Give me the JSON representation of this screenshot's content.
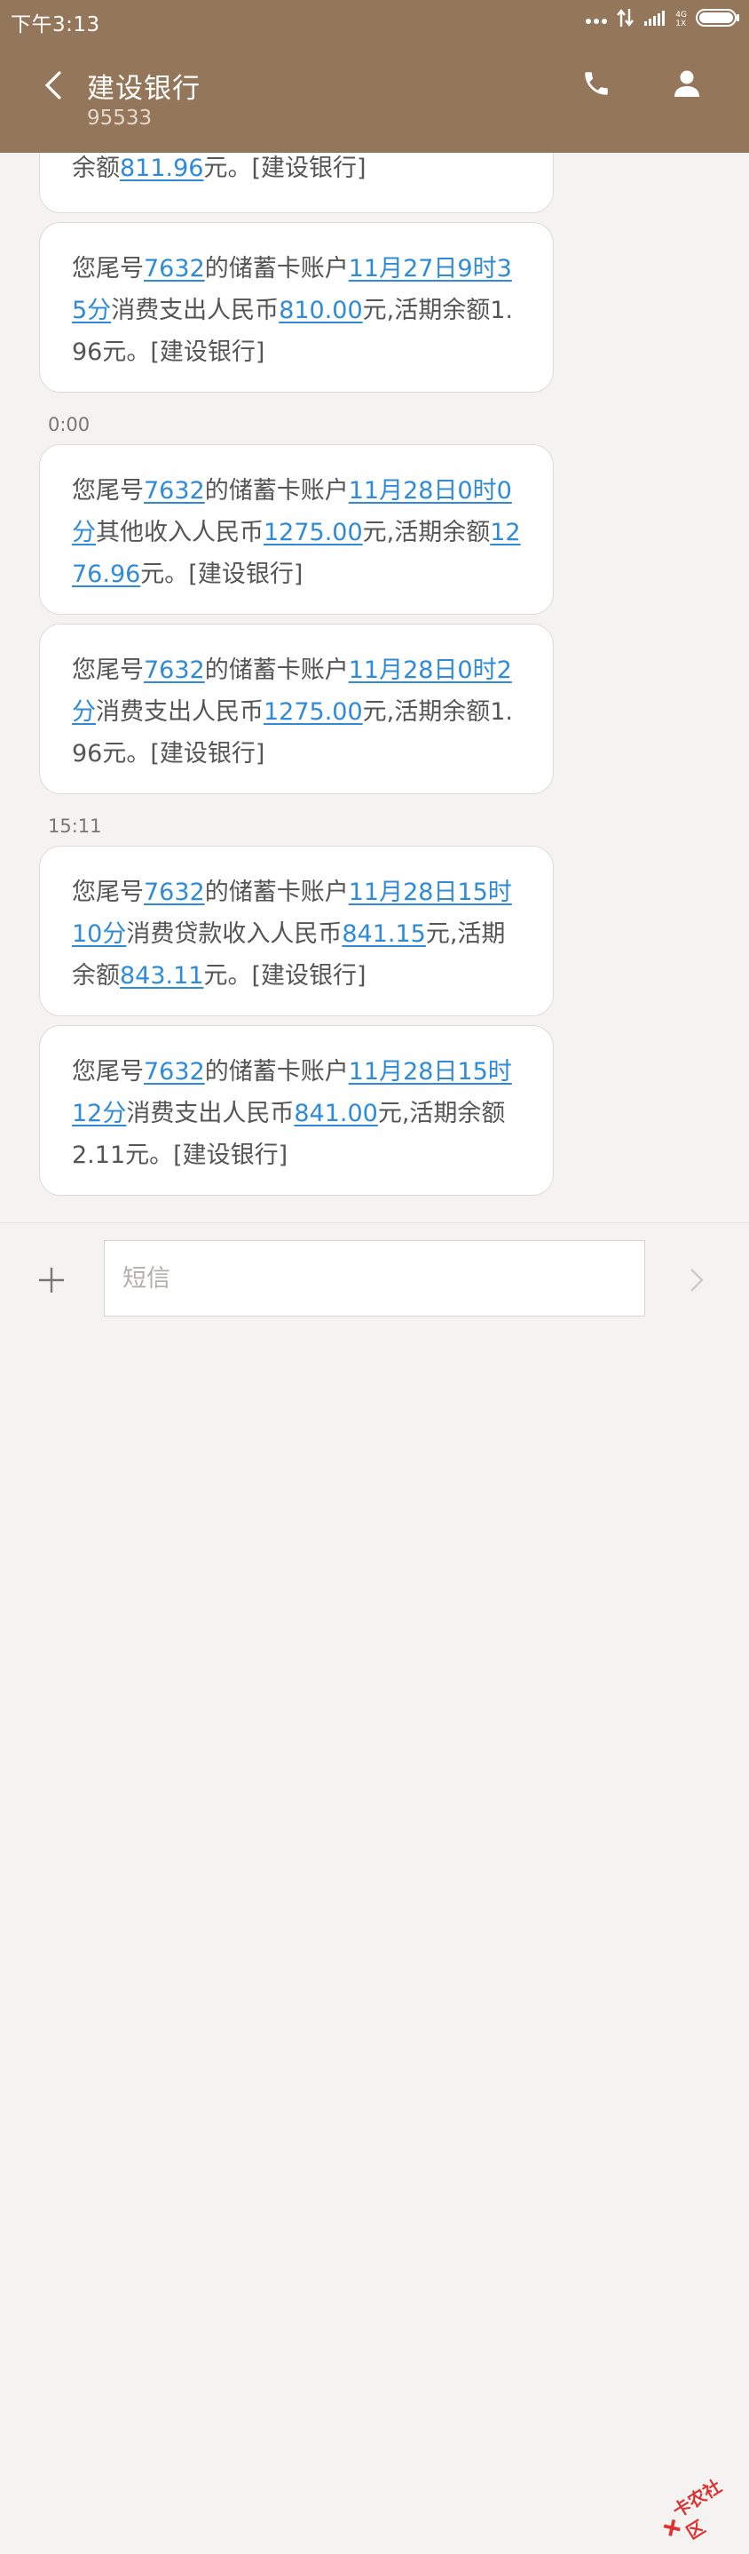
{
  "status_bar": {
    "time": "下午3:13",
    "network_label_top": "4G",
    "network_label_bottom": "1X"
  },
  "header": {
    "contact_name": "建设银行",
    "contact_number": "95533"
  },
  "messages": [
    {
      "segments": [
        {
          "t": "余额"
        },
        {
          "t": "811.96",
          "link": true
        },
        {
          "t": "元。[建设银行]"
        }
      ]
    },
    {
      "segments": [
        {
          "t": "您尾号"
        },
        {
          "t": "7632",
          "link": true
        },
        {
          "t": "的储蓄卡账户"
        },
        {
          "t": "11月27日9时35分",
          "link": true
        },
        {
          "t": "消费支出人民币"
        },
        {
          "t": "810.00",
          "link": true
        },
        {
          "t": "元,活期余额1.96元。[建设银行]"
        }
      ]
    },
    {
      "segments": [
        {
          "t": "您尾号"
        },
        {
          "t": "7632",
          "link": true
        },
        {
          "t": "的储蓄卡账户"
        },
        {
          "t": "11月28日0时0分",
          "link": true
        },
        {
          "t": "其他收入人民币"
        },
        {
          "t": "1275.00",
          "link": true
        },
        {
          "t": "元,活期余额"
        },
        {
          "t": "1276.96",
          "link": true
        },
        {
          "t": "元。[建设银行]"
        }
      ]
    },
    {
      "segments": [
        {
          "t": "您尾号"
        },
        {
          "t": "7632",
          "link": true
        },
        {
          "t": "的储蓄卡账户"
        },
        {
          "t": "11月28日0时2分",
          "link": true
        },
        {
          "t": "消费支出人民币"
        },
        {
          "t": "1275.00",
          "link": true
        },
        {
          "t": "元,活期余额1.96元。[建设银行]"
        }
      ]
    },
    {
      "segments": [
        {
          "t": "您尾号"
        },
        {
          "t": "7632",
          "link": true
        },
        {
          "t": "的储蓄卡账户"
        },
        {
          "t": "11月28日15时10分",
          "link": true
        },
        {
          "t": "消费贷款收入人民币"
        },
        {
          "t": "841.15",
          "link": true
        },
        {
          "t": "元,活期余额"
        },
        {
          "t": "843.11",
          "link": true
        },
        {
          "t": "元。[建设银行]"
        }
      ]
    },
    {
      "segments": [
        {
          "t": "您尾号"
        },
        {
          "t": "7632",
          "link": true
        },
        {
          "t": "的储蓄卡账户"
        },
        {
          "t": "11月28日15时12分",
          "link": true
        },
        {
          "t": "消费支出人民币"
        },
        {
          "t": "841.00",
          "link": true
        },
        {
          "t": "元,活期余额2.11元。[建设银行]"
        }
      ]
    }
  ],
  "timestamps": [
    "0:00",
    "15:11"
  ],
  "composer": {
    "placeholder": "短信"
  },
  "watermark": {
    "text": "卡农社区"
  },
  "colors": {
    "header_bg": "#94765a",
    "link": "#2f8bd8",
    "thread_bg": "#f4f3f1"
  }
}
